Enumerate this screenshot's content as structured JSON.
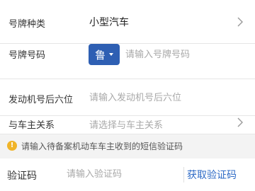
{
  "form": {
    "plate_type": {
      "label": "号牌种类",
      "value": "小型汽车"
    },
    "plate_number": {
      "label": "号牌号码",
      "province": "鲁",
      "placeholder": "请输入号牌号码"
    },
    "engine": {
      "label": "发动机号后六位",
      "placeholder": "请输入发动机号后六位"
    },
    "relation": {
      "label": "与车主关系",
      "placeholder": "请选择与车主关系"
    }
  },
  "notice": {
    "text": "请输入待备案机动车车主收到的短信验证码",
    "icon": "warning-icon"
  },
  "verify": {
    "label": "验证码",
    "placeholder": "请输入验证码",
    "get_code_label": "获取验证码"
  },
  "colors": {
    "accent": "#2e5fb3",
    "link": "#2e6bc6",
    "warning": "#f0b429"
  }
}
